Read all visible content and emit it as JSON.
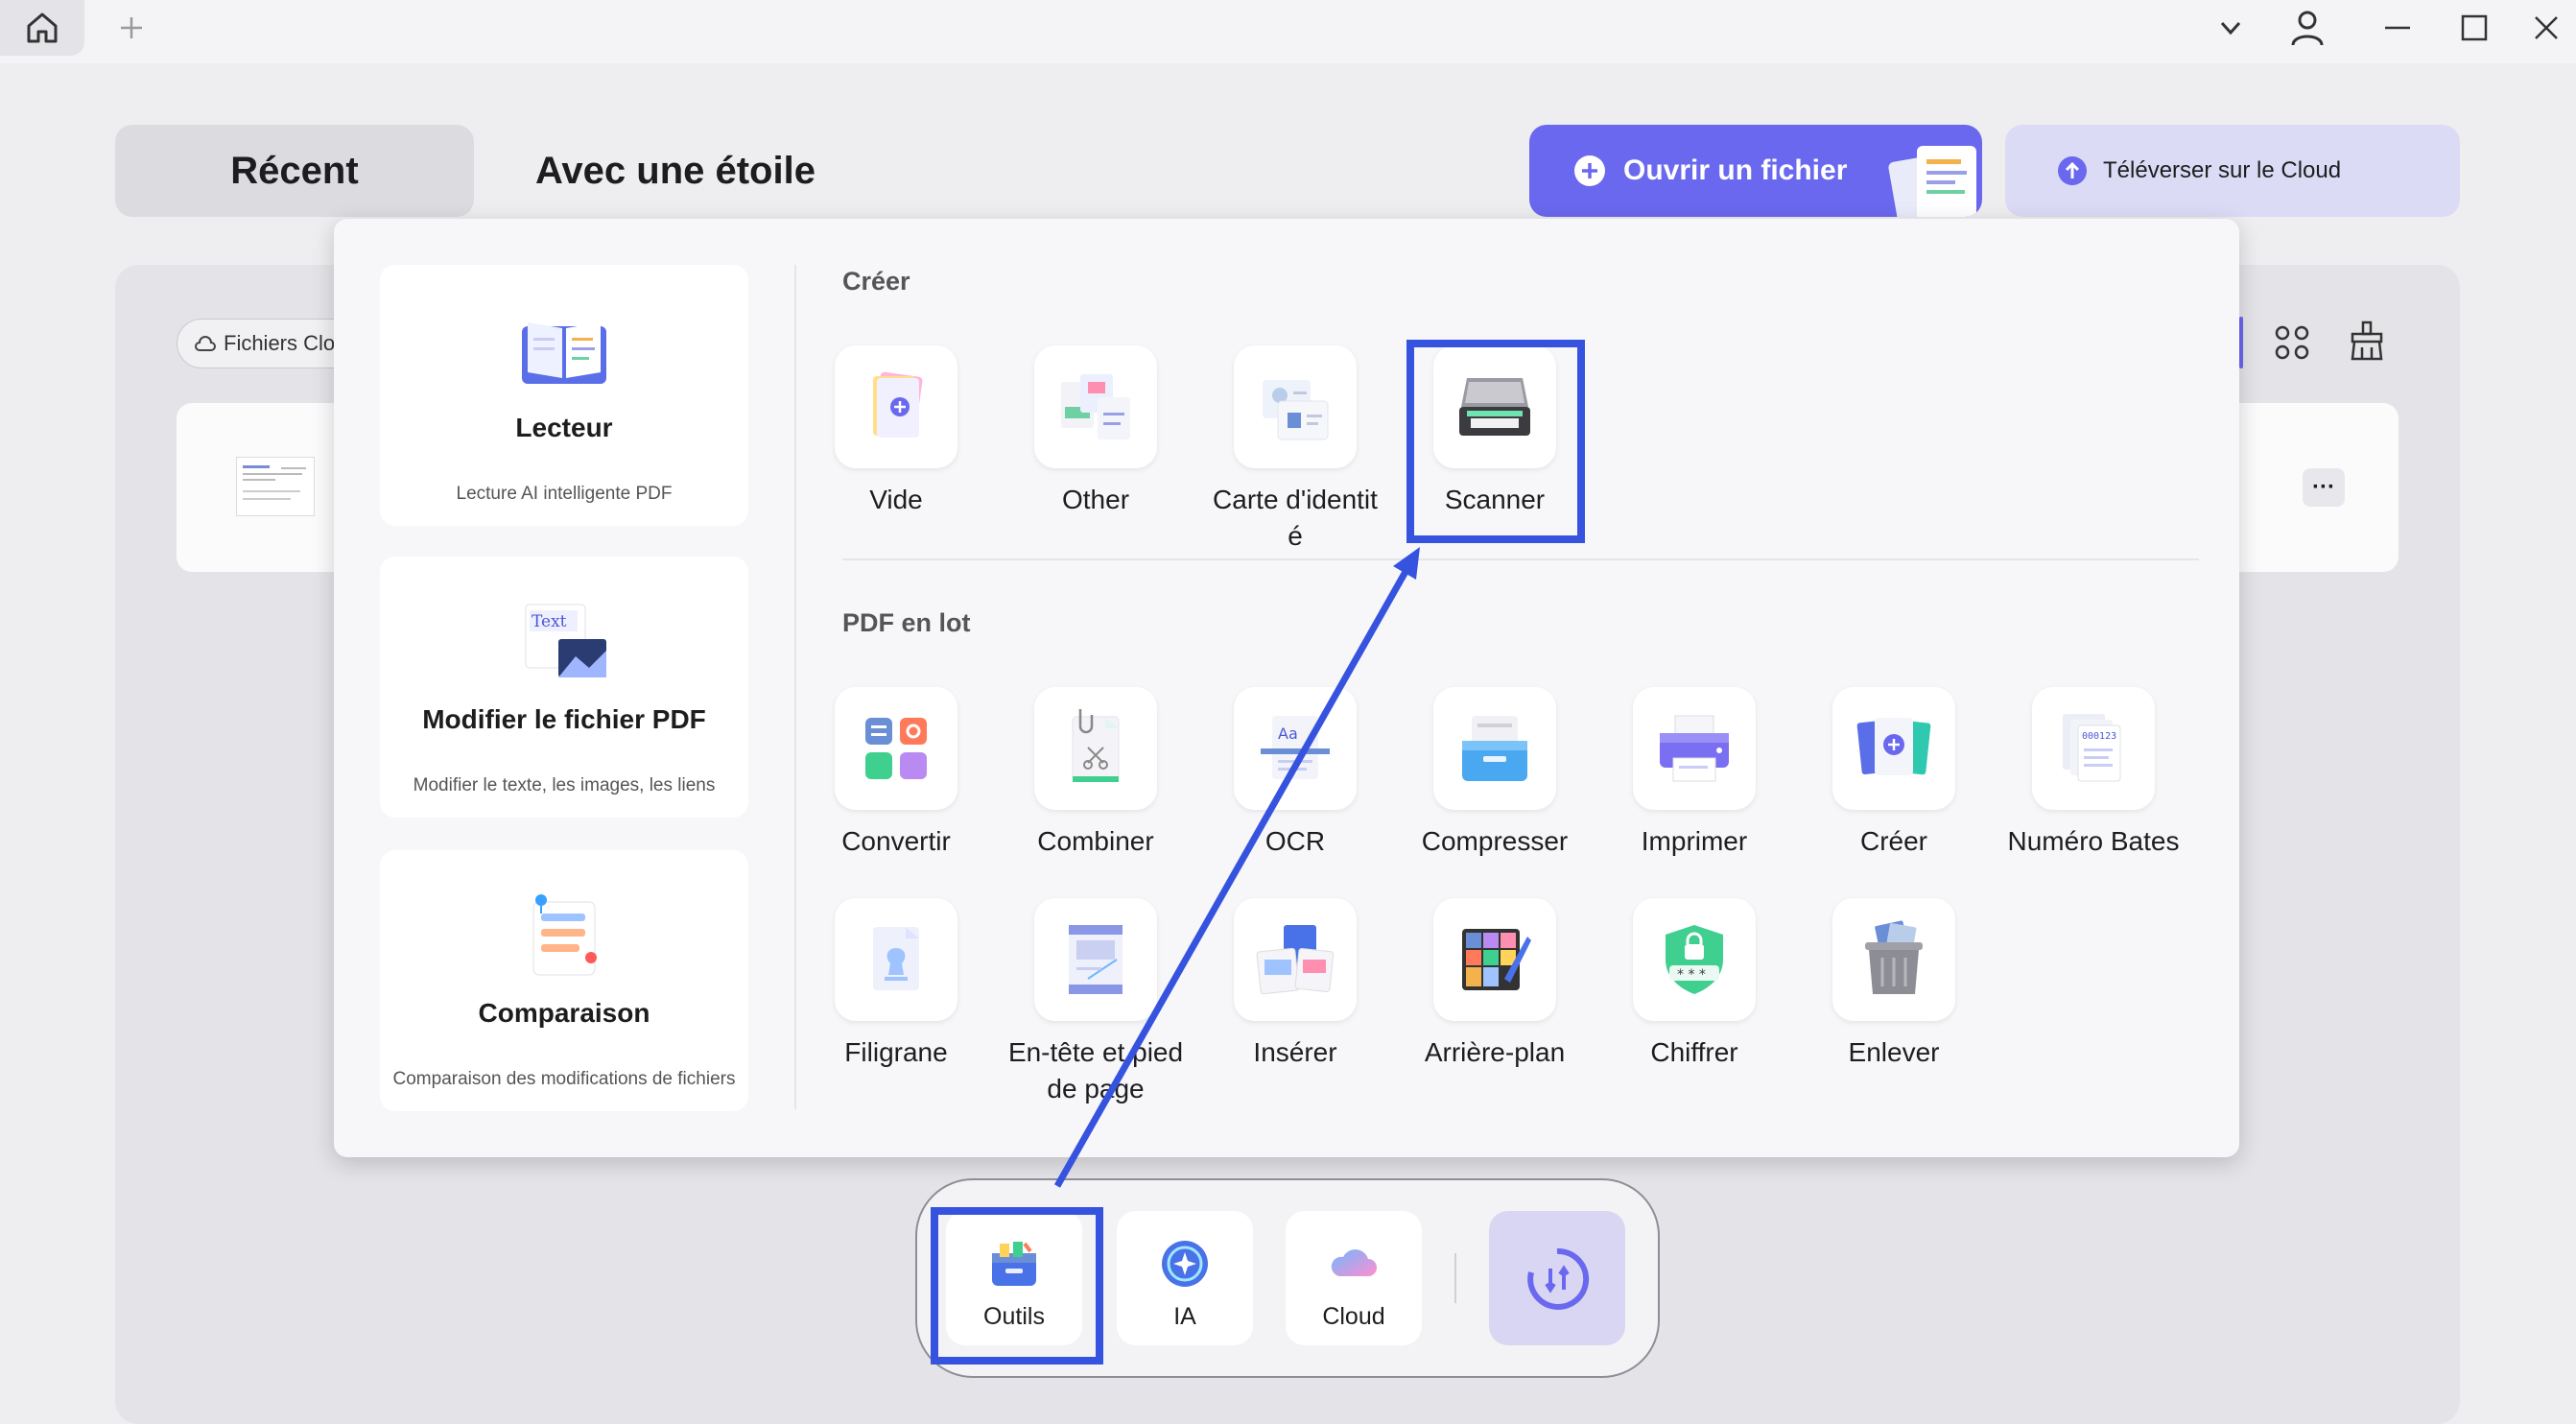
{
  "titlebar": {
    "icons": [
      "home-icon",
      "plus-icon",
      "chevron-down-icon",
      "user-icon",
      "minimize-icon",
      "maximize-icon",
      "close-icon"
    ]
  },
  "tabs": {
    "recent": "Récent",
    "starred": "Avec une étoile"
  },
  "actions": {
    "open_file": "Ouvrir un fichier",
    "upload_cloud": "Téléverser sur le Cloud"
  },
  "files": {
    "filter_label": "Fichiers Clo",
    "more": "···"
  },
  "sidebar_cards": [
    {
      "title": "Lecteur",
      "subtitle": "Lecture AI intelligente PDF"
    },
    {
      "title": "Modifier le fichier PDF",
      "subtitle": "Modifier le texte, les images, les liens",
      "icon_text": "Text"
    },
    {
      "title": "Comparaison",
      "subtitle": "Comparaison des modifications de fichiers"
    }
  ],
  "create_section": {
    "title": "Créer",
    "tools": [
      "Vide",
      "Other",
      "Carte d'identit\né",
      "Scanner"
    ]
  },
  "batch_section": {
    "title": "PDF en lot",
    "row1": [
      "Convertir",
      "Combiner",
      "OCR",
      "Compresser",
      "Imprimer",
      "Créer",
      "Numéro Bates"
    ],
    "row2": [
      "Filigrane",
      "En-tête et pied\nde page",
      "Insérer",
      "Arrière-plan",
      "Chiffrer",
      "Enlever"
    ]
  },
  "dock": {
    "items": [
      "Outils",
      "IA",
      "Cloud"
    ]
  },
  "colors": {
    "accent": "#6a68ee",
    "highlight": "#3653e0"
  }
}
